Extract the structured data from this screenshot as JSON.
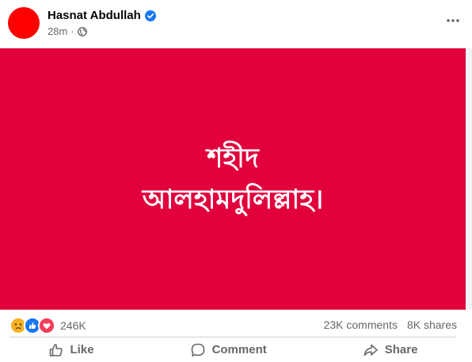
{
  "post": {
    "author": "Hasnat Abdullah",
    "time": "28m",
    "separator": "·",
    "content_lines": [
      "শহীদ",
      "আলহামদুলিল্লাহ।"
    ],
    "reaction_count": "246K",
    "comments": "23K comments",
    "shares": "8K shares"
  },
  "actions": {
    "like": "Like",
    "comment": "Comment",
    "share": "Share"
  },
  "colors": {
    "avatar": "#ff0000",
    "content_bg": "#e1003c",
    "verified": "#1877f2",
    "like_reaction": "#1877f2",
    "love_reaction": "#f33e58",
    "sad_reaction": "#f7b125"
  },
  "icons": {
    "verified": "verified-badge-icon",
    "audience": "globe-icon",
    "more": "more-options-icon",
    "reactions": [
      "sad-reaction-icon",
      "like-reaction-icon",
      "love-reaction-icon"
    ],
    "like": "thumbs-up-icon",
    "comment": "comment-bubble-icon",
    "share": "share-arrow-icon"
  }
}
